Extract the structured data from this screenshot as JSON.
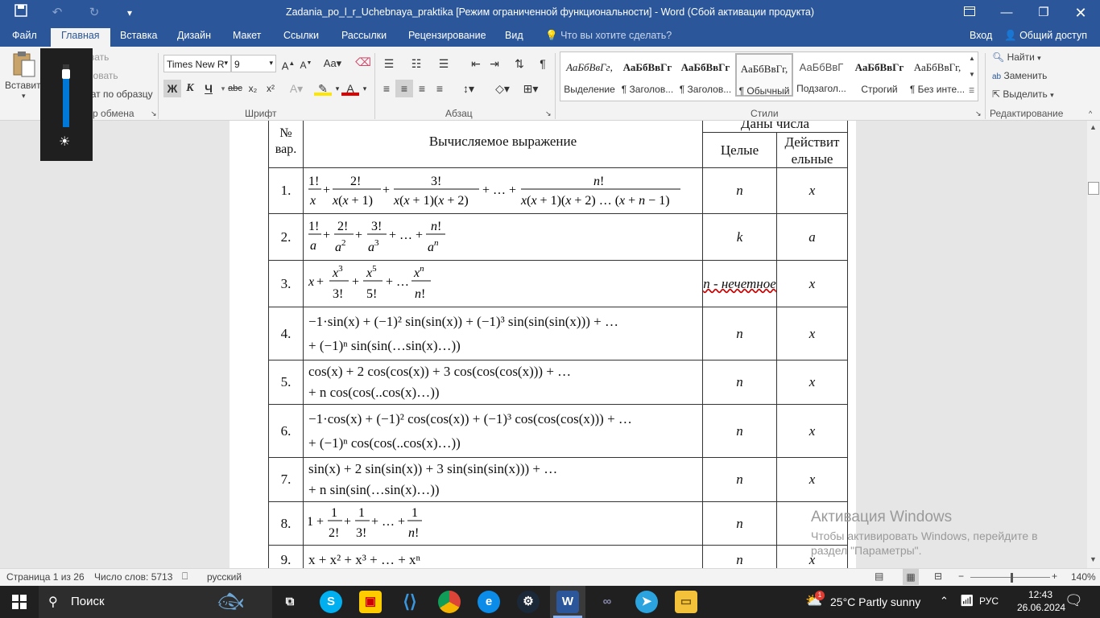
{
  "titlebar": {
    "title": "Zadania_po_l_r_Uchebnaya_praktika [Режим ограниченной функциональности] - Word (Сбой активации продукта)"
  },
  "tabs": [
    {
      "label": "Файл"
    },
    {
      "label": "Главная"
    },
    {
      "label": "Вставка"
    },
    {
      "label": "Дизайн"
    },
    {
      "label": "Макет"
    },
    {
      "label": "Ссылки"
    },
    {
      "label": "Рассылки"
    },
    {
      "label": "Рецензирование"
    },
    {
      "label": "Вид"
    }
  ],
  "tell_me": "Что вы хотите сделать?",
  "signin": "Вход",
  "share": "Общий доступ",
  "clipboard": {
    "paste": "Вставить",
    "cut": "Вырезать",
    "copy": "Копировать",
    "format_painter": "Формат по образцу",
    "group": "Буфер обмена"
  },
  "font": {
    "name": "Times New R",
    "size": "9",
    "group": "Шрифт",
    "bold": "Ж",
    "italic": "К",
    "underline": "Ч",
    "strike": "abc",
    "sub": "x₂",
    "sup": "x²"
  },
  "paragraph": {
    "group": "Абзац"
  },
  "styles": {
    "group": "Стили",
    "items": [
      {
        "sample": "АаБбВвГг,",
        "name": "Выделение"
      },
      {
        "sample": "АаБбВвГг",
        "name": "¶ Заголов..."
      },
      {
        "sample": "АаБбВвГг",
        "name": "¶ Заголов..."
      },
      {
        "sample": "АаБбВвГг,",
        "name": "¶ Обычный"
      },
      {
        "sample": "АаБбВвГ",
        "name": "Подзагол..."
      },
      {
        "sample": "АаБбВвГг",
        "name": "Строгий"
      },
      {
        "sample": "АаБбВвГг,",
        "name": "¶ Без инте..."
      }
    ]
  },
  "editing": {
    "find": "Найти",
    "replace": "Заменить",
    "select": "Выделить",
    "group": "Редактирование"
  },
  "table": {
    "header": {
      "num": "№ вар.",
      "expr": "Вычисляемое выражение",
      "given": "Даны числа",
      "int": "Целые",
      "real": "Действит ельные"
    },
    "rows": [
      {
        "n": "1.",
        "int": "n",
        "real": "x"
      },
      {
        "n": "2.",
        "int": "k",
        "real": "a"
      },
      {
        "n": "3.",
        "int": "n - нечетное",
        "real": "x"
      },
      {
        "n": "4.",
        "expr1": "−1·sin(x) + (−1)² sin(sin(x)) + (−1)³ sin(sin(sin(x))) + …",
        "expr2": "+ (−1)ⁿ sin(sin(…sin(x)…))",
        "int": "n",
        "real": "x"
      },
      {
        "n": "5.",
        "expr1": "cos(x) + 2 cos(cos(x)) + 3 cos(cos(cos(x))) + …",
        "expr2": "+ n cos(cos(..cos(x)…))",
        "int": "n",
        "real": "x"
      },
      {
        "n": "6.",
        "expr1": "−1·cos(x) + (−1)² cos(cos(x)) + (−1)³ cos(cos(cos(x))) + …",
        "expr2": "+ (−1)ⁿ cos(cos(..cos(x)…))",
        "int": "n",
        "real": "x"
      },
      {
        "n": "7.",
        "expr1": "sin(x) + 2 sin(sin(x)) + 3 sin(sin(sin(x))) + …",
        "expr2": "+ n sin(sin(…sin(x)…))",
        "int": "n",
        "real": "x"
      },
      {
        "n": "8.",
        "int": "n",
        "real": ""
      },
      {
        "n": "9.",
        "expr1": "x + x² + x³ + … + xⁿ",
        "int": "n",
        "real": "x"
      }
    ]
  },
  "watermark": {
    "line1": "Активация Windows",
    "line2": "Чтобы активировать Windows, перейдите в",
    "line3": "раздел \"Параметры\"."
  },
  "status": {
    "page": "Страница 1 из 26",
    "words": "Число слов: 5713",
    "lang": "русский",
    "zoom": "140%"
  },
  "taskbar": {
    "search": "Поиск",
    "weather": "25°C  Partly sunny",
    "lang": "РУС",
    "time": "12:43",
    "date": "26.06.2024",
    "weather_badge": "1"
  },
  "brightness_level": 0.85
}
